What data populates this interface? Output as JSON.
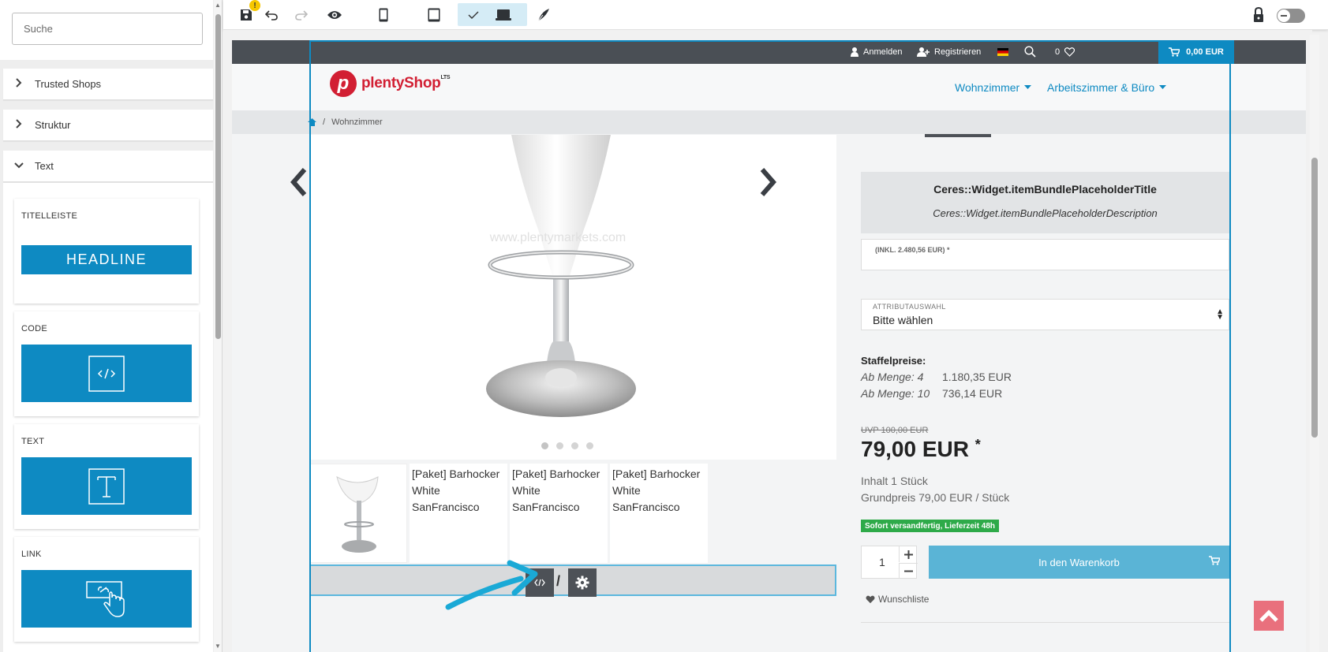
{
  "sidebar": {
    "search_placeholder": "Suche",
    "accordion": [
      {
        "label": "Trusted Shops",
        "state": "collapsed"
      },
      {
        "label": "Struktur",
        "state": "collapsed"
      },
      {
        "label": "Text",
        "state": "expanded"
      }
    ],
    "widgets": [
      {
        "label": "TITELLEISTE",
        "preview": "HEADLINE",
        "icon": "headline"
      },
      {
        "label": "CODE",
        "icon": "code-icon"
      },
      {
        "label": "TEXT",
        "icon": "text-icon"
      },
      {
        "label": "LINK",
        "icon": "link-hand-icon"
      }
    ]
  },
  "toolbar": {
    "warning_badge": "!",
    "buttons": [
      "save-icon",
      "undo-icon",
      "redo-icon",
      "preview-eye-icon",
      "mobile-icon",
      "tablet-icon",
      "desktop-icon",
      "pen-icon"
    ],
    "active_device": "desktop",
    "lock_icon": "lock-icon",
    "toggle_state": "off"
  },
  "shop": {
    "topbar": {
      "login": "Anmelden",
      "register": "Registrieren",
      "wishlist_count": "0",
      "cart_total": "0,00 EUR"
    },
    "logo_text": "plentyShop",
    "logo_sup": "LTS",
    "nav": [
      "Wohnzimmer",
      "Arbeitszimmer & Büro"
    ],
    "breadcrumb": {
      "separator": "/",
      "current": "Wohnzimmer"
    },
    "product": {
      "image_watermark": "www.plentymarkets.com",
      "thumbnail_alt": [
        "[Paket] Barhocker White SanFrancisco",
        "[Paket] Barhocker White SanFrancisco",
        "[Paket] Barhocker White SanFrancisco"
      ],
      "bundle_title": "Ceres::Widget.itemBundlePlaceholderTitle",
      "bundle_desc": "Ceres::Widget.itemBundlePlaceholderDescription",
      "price_field_label": "(INKL. 2.480,56 EUR) *",
      "attribute_label": "ATTRIBUTAUSWAHL",
      "attribute_value": "Bitte wählen",
      "staffel_title": "Staffelpreise:",
      "staffel": [
        {
          "qty": "Ab Menge: 4",
          "price": "1.180,35 EUR"
        },
        {
          "qty": "Ab Menge: 10",
          "price": "736,14 EUR"
        }
      ],
      "uvp": "UVP 100,00 EUR",
      "price": "79,00 EUR",
      "price_star": "*",
      "content": "Inhalt 1 Stück",
      "base_price": "Grundpreis 79,00 EUR / Stück",
      "availability": "Sofort versandfertig, Lieferzeit 48h",
      "quantity": "1",
      "add_to_cart": "In den Warenkorb",
      "wishlist": "Wunschliste"
    },
    "widget_bar": {
      "separator": "/"
    }
  },
  "colors": {
    "accent": "#0e8ac2",
    "logo_red": "#d21f33",
    "badge_green": "#2eaa49",
    "cart_button": "#5ab4d6",
    "to_top": "#e9707d"
  }
}
